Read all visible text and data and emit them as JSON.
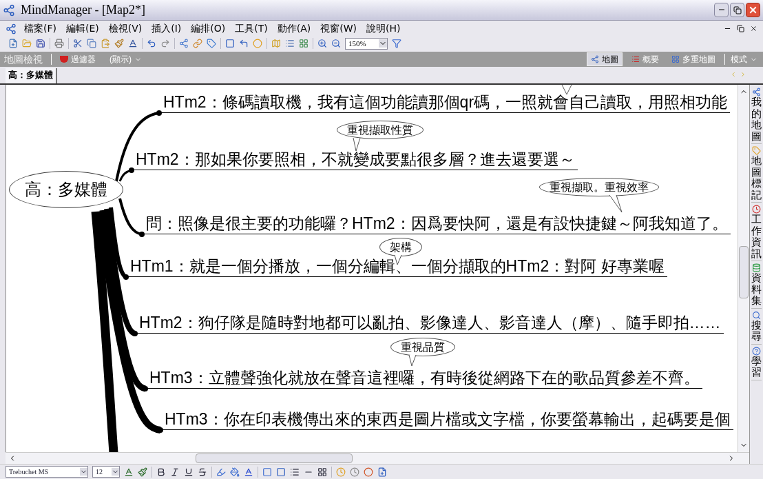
{
  "window": {
    "title": "MindManager - [Map2*]"
  },
  "menu": [
    "檔案(F)",
    "編輯(E)",
    "檢視(V)",
    "插入(I)",
    "編排(O)",
    "工具(T)",
    "動作(A)",
    "視窗(W)",
    "說明(H)"
  ],
  "toolbar": {
    "zoom": "150%"
  },
  "view_bar": {
    "title": "地圖檢視",
    "filter": "過濾器",
    "display": "(顯示)",
    "mode": "模式",
    "views": [
      {
        "label": "地圖",
        "selected": true
      },
      {
        "label": "概要",
        "selected": false
      },
      {
        "label": "多重地圖",
        "selected": false
      }
    ]
  },
  "document_tab": {
    "label": "高：多媒體",
    "selected": true
  },
  "map": {
    "central_topic": "高：多媒體",
    "topics": [
      {
        "text": "HTm2：條碼讀取機，我有這個功能讀那個qr碼，一照就會自己讀取，用照相功能"
      },
      {
        "text": "HTm2：那如果你要照相，不就變成要點很多層？進去還要選～",
        "callout": "重視擷取性質"
      },
      {
        "text": "問：照像是很主要的功能囉？HTm2：因爲要快阿，還是有設快捷鍵～阿我知道了。",
        "callout": "重視擷取。重視效率"
      },
      {
        "text": "HTm1：就是一個分播放，一個分編輯、一個分擷取的HTm2：對阿 好專業喔",
        "callout": "架構"
      },
      {
        "text": "HTm2：狗仔隊是隨時對地都可以亂拍、影像達人、影音達人（摩）、隨手即拍……"
      },
      {
        "text": "HTm3：立體聲強化就放在聲音這裡囉，有時後從網路下在的歌品質參差不齊。",
        "callout": "重視品質"
      },
      {
        "text": "HTm3：你在印表機傳出來的東西是圖片檔或文字檔，你要螢幕輸出，起碼要是個"
      }
    ]
  },
  "side_panel": [
    "我的地圖",
    "地圖標記",
    "工作資訊",
    "資料集",
    "搜尋",
    "學習"
  ],
  "format_bar": {
    "font": "Trebuchet MS",
    "size": "12"
  }
}
